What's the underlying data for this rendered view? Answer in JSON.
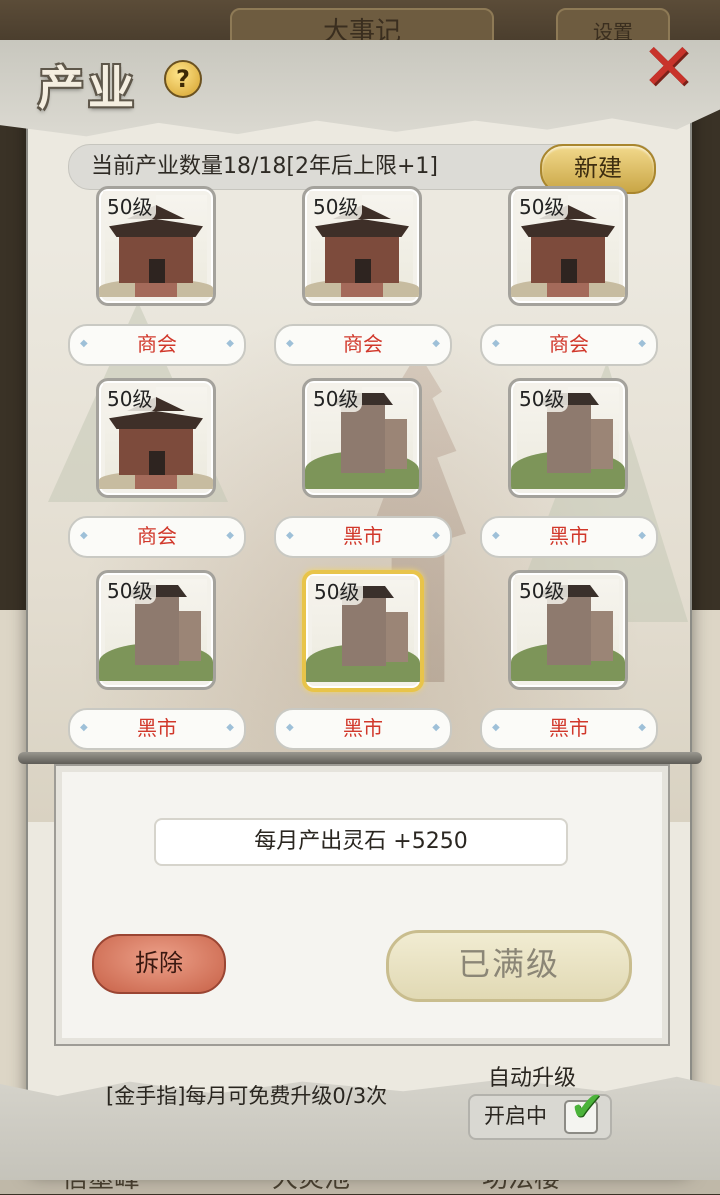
{
  "background": {
    "top_tabs": [
      "大事记",
      "设置"
    ],
    "bottom_text": [
      "信墨峰",
      "大炎池",
      "功法楼"
    ]
  },
  "panel": {
    "title": "产业",
    "help_icon": "question-icon",
    "close_icon": "close-icon",
    "count_text": "当前产业数量18/18[2年后上限+1]",
    "new_button": "新建"
  },
  "industries": [
    {
      "level": "50级",
      "name": "商会",
      "type": "shanghui",
      "selected": false
    },
    {
      "level": "50级",
      "name": "商会",
      "type": "shanghui",
      "selected": false
    },
    {
      "level": "50级",
      "name": "商会",
      "type": "shanghui",
      "selected": false
    },
    {
      "level": "50级",
      "name": "商会",
      "type": "shanghui",
      "selected": false
    },
    {
      "level": "50级",
      "name": "黑市",
      "type": "heishi",
      "selected": false
    },
    {
      "level": "50级",
      "name": "黑市",
      "type": "heishi",
      "selected": false
    },
    {
      "level": "50级",
      "name": "黑市",
      "type": "heishi",
      "selected": false
    },
    {
      "level": "50级",
      "name": "黑市",
      "type": "heishi",
      "selected": true
    },
    {
      "level": "50级",
      "name": "黑市",
      "type": "heishi",
      "selected": false
    }
  ],
  "detail": {
    "output_text": "每月产出灵石 +5250",
    "demolish_button": "拆除",
    "max_level_button": "已满级"
  },
  "footer": {
    "golden_finger": "[金手指]每月可免费升级0/3次",
    "auto_upgrade_label": "自动升级",
    "auto_upgrade_state": "开启中",
    "auto_upgrade_checked": true
  },
  "colors": {
    "name_text": "#d1382b",
    "selected_border": "#e8c44a",
    "check_green": "#4bb33a"
  }
}
